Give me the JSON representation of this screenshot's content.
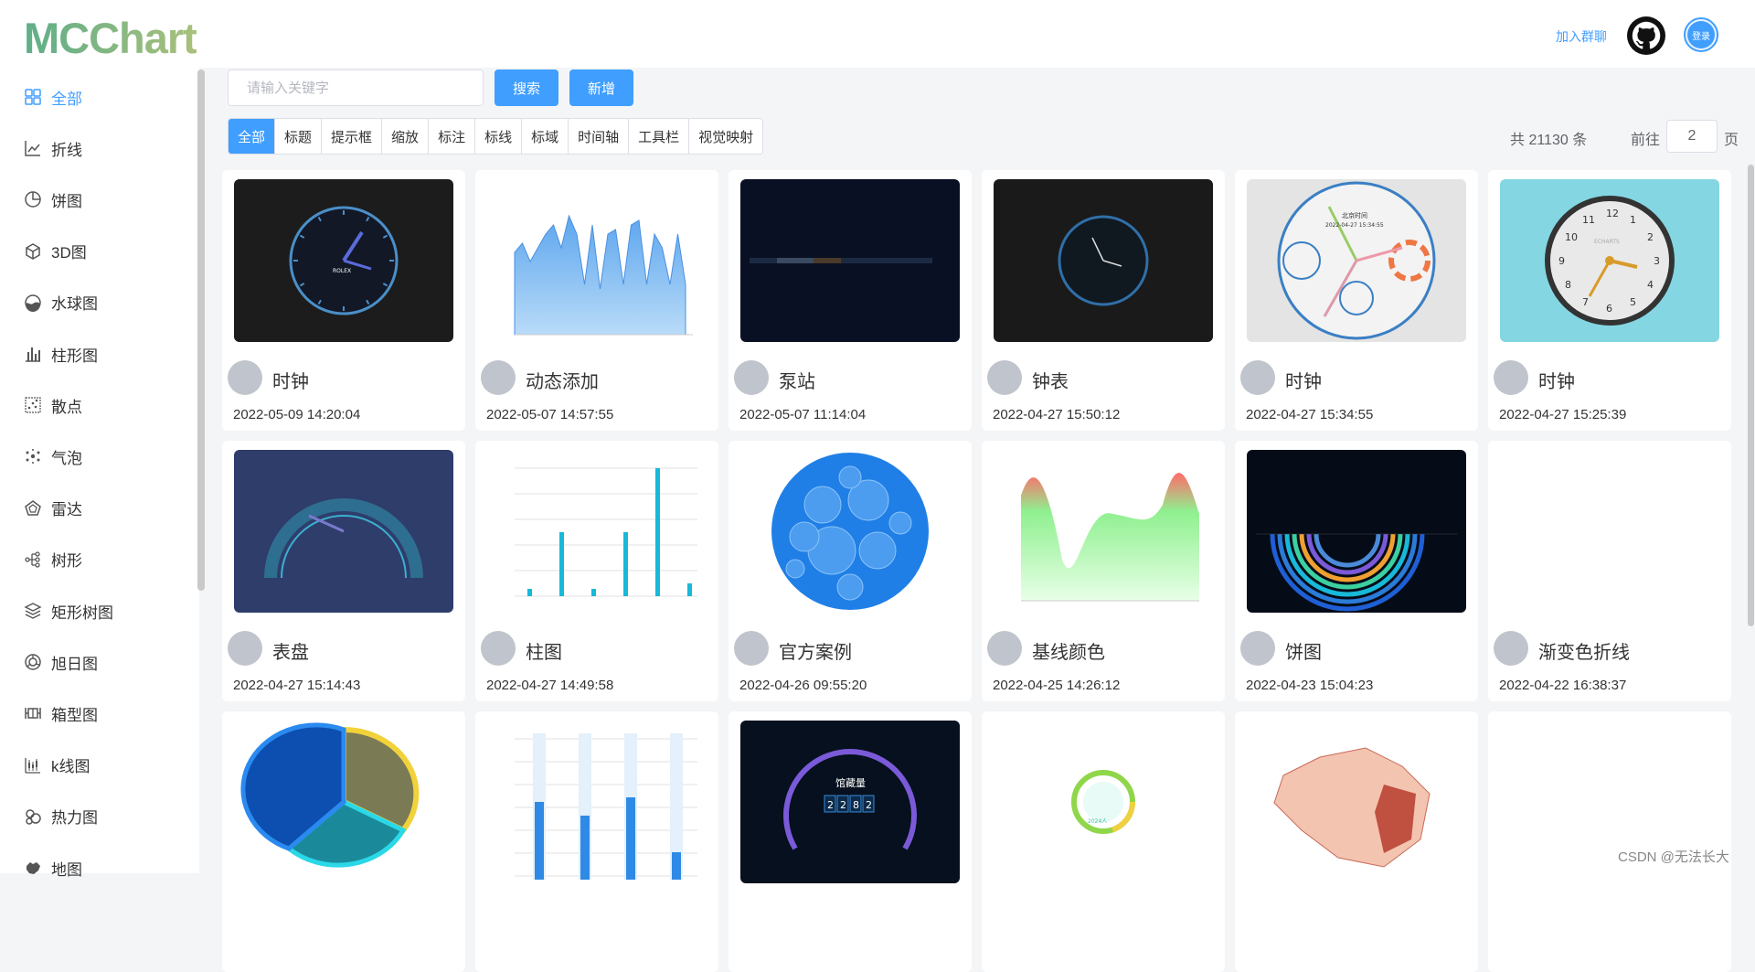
{
  "header": {
    "logo": "MCChart",
    "join_label": "加入群聊",
    "login_label": "登录"
  },
  "sidebar": {
    "items": [
      {
        "label": "全部",
        "icon": "grid-icon",
        "active": true
      },
      {
        "label": "折线",
        "icon": "line-chart-icon"
      },
      {
        "label": "饼图",
        "icon": "pie-chart-icon"
      },
      {
        "label": "3D图",
        "icon": "cube-icon"
      },
      {
        "label": "水球图",
        "icon": "liquid-ball-icon"
      },
      {
        "label": "柱形图",
        "icon": "bar-chart-icon"
      },
      {
        "label": "散点",
        "icon": "scatter-icon"
      },
      {
        "label": "气泡",
        "icon": "bubble-icon"
      },
      {
        "label": "雷达",
        "icon": "radar-icon"
      },
      {
        "label": "树形",
        "icon": "tree-icon"
      },
      {
        "label": "矩形树图",
        "icon": "layers-icon"
      },
      {
        "label": "旭日图",
        "icon": "sunburst-icon"
      },
      {
        "label": "箱型图",
        "icon": "boxplot-icon"
      },
      {
        "label": "k线图",
        "icon": "candlestick-icon"
      },
      {
        "label": "热力图",
        "icon": "heatmap-icon"
      },
      {
        "label": "地图",
        "icon": "map-icon"
      }
    ]
  },
  "toolbar": {
    "search_placeholder": "请输入关键字",
    "search_label": "搜索",
    "add_label": "新增"
  },
  "filters": [
    "全部",
    "标题",
    "提示框",
    "缩放",
    "标注",
    "标线",
    "标域",
    "时间轴",
    "工具栏",
    "视觉映射"
  ],
  "pagination": {
    "total_text": "共 21130 条",
    "goto_label": "前往",
    "page_value": "2",
    "page_suffix": "页"
  },
  "cards": [
    {
      "title": "时钟",
      "date": "2022-05-09 14:20:04",
      "thumb": "clock-dark"
    },
    {
      "title": "动态添加",
      "date": "2022-05-07 14:57:55",
      "thumb": "area-chart"
    },
    {
      "title": "泵站",
      "date": "2022-05-07 11:14:04",
      "thumb": "pump-station"
    },
    {
      "title": "钟表",
      "date": "2022-04-27 15:50:12",
      "thumb": "clock-minimal"
    },
    {
      "title": "时钟",
      "date": "2022-04-27 15:34:55",
      "thumb": "clock-multi"
    },
    {
      "title": "时钟",
      "date": "2022-04-27 15:25:39",
      "thumb": "clock-cyan"
    },
    {
      "title": "表盘",
      "date": "2022-04-27 15:14:43",
      "thumb": "gauge"
    },
    {
      "title": "柱图",
      "date": "2022-04-27 14:49:58",
      "thumb": "bar-chart"
    },
    {
      "title": "官方案例",
      "date": "2022-04-26 09:55:20",
      "thumb": "circle-packing"
    },
    {
      "title": "基线颜色",
      "date": "2022-04-25 14:26:12",
      "thumb": "baseline-area"
    },
    {
      "title": "饼图",
      "date": "2022-04-23 15:04:23",
      "thumb": "radial-bars"
    },
    {
      "title": "渐变色折线",
      "date": "2022-04-22 16:38:37",
      "thumb": "blank"
    },
    {
      "title": "",
      "date": "",
      "thumb": "pie-3d"
    },
    {
      "title": "",
      "date": "",
      "thumb": "bar-grid"
    },
    {
      "title": "",
      "date": "",
      "thumb": "storage-gauge"
    },
    {
      "title": "",
      "date": "",
      "thumb": "ring-light"
    },
    {
      "title": "",
      "date": "",
      "thumb": "china-map"
    },
    {
      "title": "",
      "date": "",
      "thumb": "blank"
    }
  ],
  "thumb_text": {
    "clock_brand": "ROLEX",
    "multi_title": "北京时间",
    "multi_time": "2022-04-27 15:34:55",
    "cyan_brand": "ECHARTS",
    "storage_label": "馆藏量",
    "storage_digits": [
      "2",
      "2",
      "8",
      "2"
    ],
    "ring_label": "2024人"
  },
  "watermark": "CSDN @无法长大"
}
